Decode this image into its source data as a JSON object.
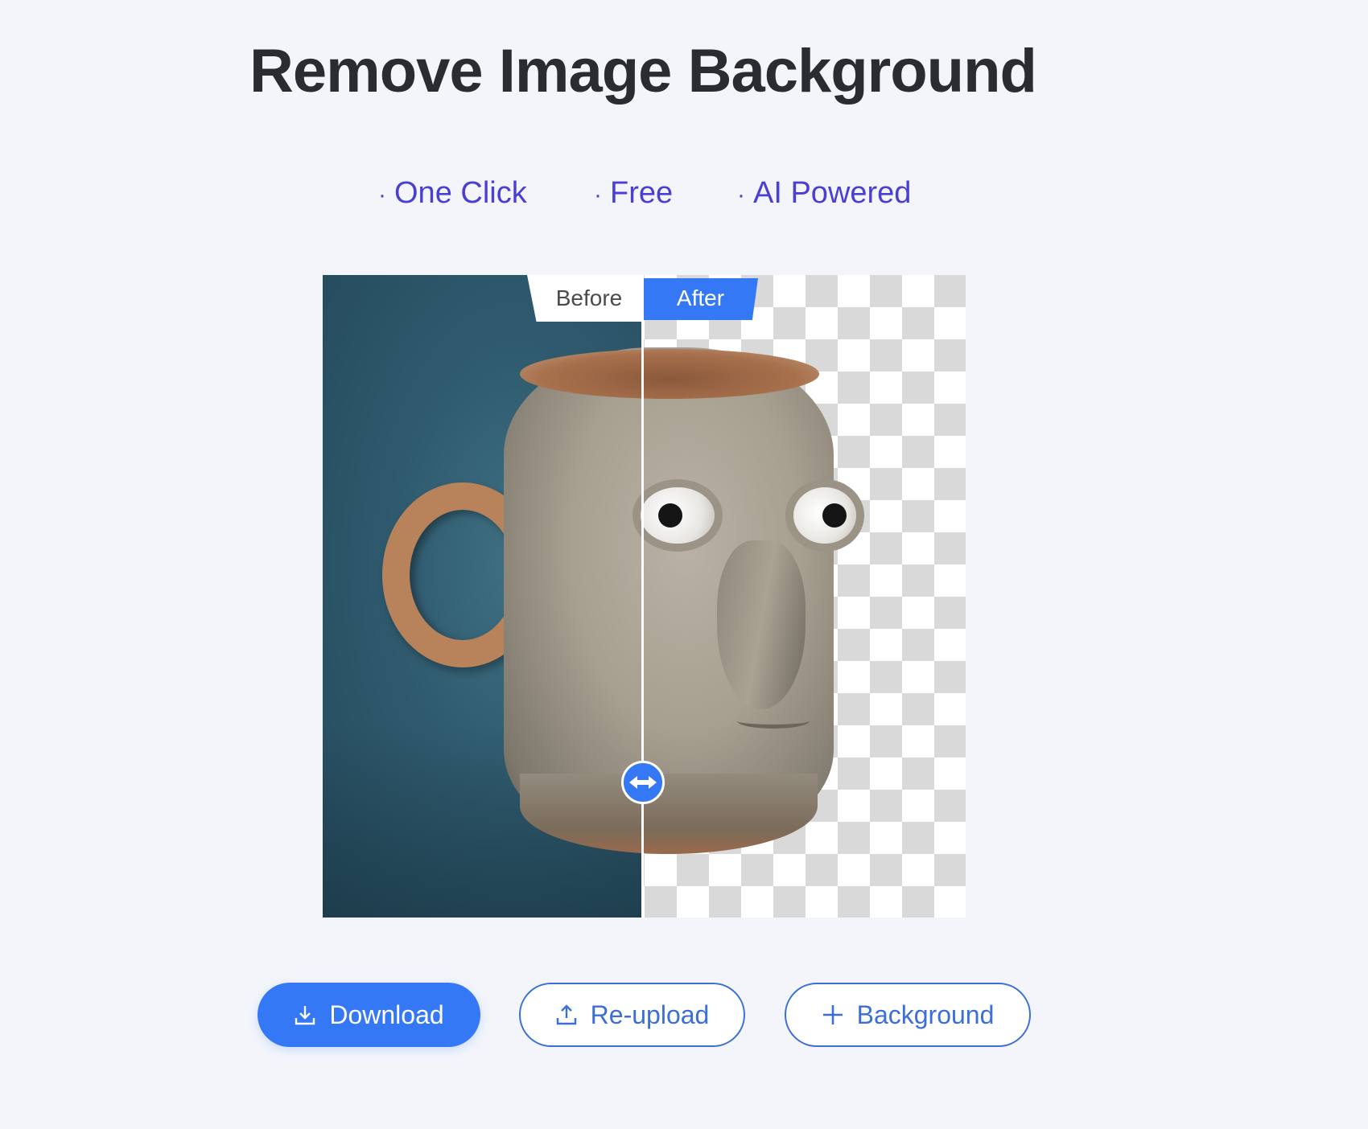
{
  "page": {
    "title": "Remove Image Background"
  },
  "features": [
    {
      "bullet": "·",
      "label": "One Click"
    },
    {
      "bullet": "·",
      "label": "Free"
    },
    {
      "bullet": "·",
      "label": "AI Powered"
    }
  ],
  "comparison": {
    "before_label": "Before",
    "after_label": "After",
    "slider_position_percent": 50,
    "handle_icon": "left-right-arrows-icon"
  },
  "actions": {
    "download": {
      "label": "Download",
      "icon": "download-icon"
    },
    "reupload": {
      "label": "Re-upload",
      "icon": "upload-icon"
    },
    "background": {
      "label": "Background",
      "icon": "plus-icon"
    }
  },
  "colors": {
    "accent": "#3478f6",
    "feature_text": "#4a3fd2",
    "title_text": "#2b2c30",
    "page_background": "#f3f5fb"
  }
}
